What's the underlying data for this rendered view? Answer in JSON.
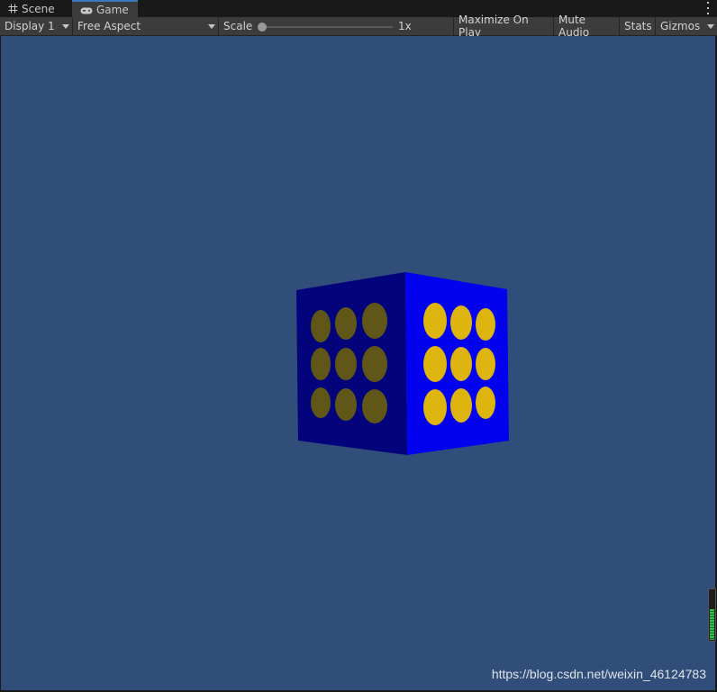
{
  "tabs": {
    "scene": {
      "label": "Scene",
      "icon": "grid-icon"
    },
    "game": {
      "label": "Game",
      "icon": "gamepad-icon"
    }
  },
  "toolbar": {
    "display": "Display 1",
    "aspect": "Free Aspect",
    "scale_label": "Scale",
    "scale_value": "1x",
    "scale_fraction": 0.0,
    "maximize": "Maximize On Play",
    "mute": "Mute Audio",
    "stats": "Stats",
    "gizmos": "Gizmos"
  },
  "viewport": {
    "background": "#314d79",
    "cube": {
      "dark_face_color": "#03037c",
      "light_face_color": "#0202ef",
      "dark_dot_color": "#605617",
      "light_dot_color": "#deb40e",
      "dots_per_face": 9
    },
    "audio_level": 0.62,
    "watermark": "https://blog.csdn.net/weixin_46124783"
  }
}
